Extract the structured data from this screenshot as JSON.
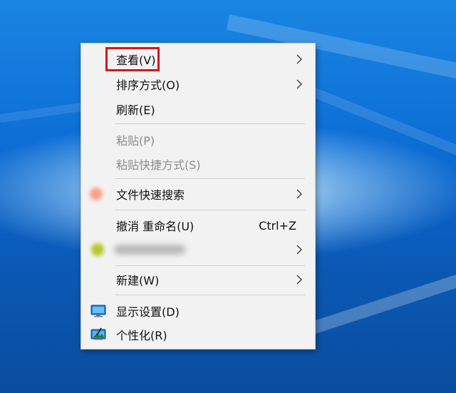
{
  "context_menu": {
    "items": [
      {
        "label": "查看(V)",
        "submenu": true
      },
      {
        "label": "排序方式(O)",
        "submenu": true
      },
      {
        "label": "刷新(E)"
      },
      {
        "label": "粘贴(P)",
        "disabled": true
      },
      {
        "label": "粘贴快捷方式(S)",
        "disabled": true
      },
      {
        "label": "文件快速搜索",
        "submenu": true
      },
      {
        "label": "撤消 重命名(U)",
        "shortcut": "Ctrl+Z"
      },
      {
        "label": "",
        "submenu": true,
        "blurred": true
      },
      {
        "label": "新建(W)",
        "submenu": true
      },
      {
        "label": "显示设置(D)",
        "icon": "display-settings-icon"
      },
      {
        "label": "个性化(R)",
        "icon": "personalize-icon"
      }
    ]
  },
  "colors": {
    "highlight": "#d8141c",
    "menu_bg": "#f2f2f2",
    "disabled_text": "#8c8c8c"
  }
}
